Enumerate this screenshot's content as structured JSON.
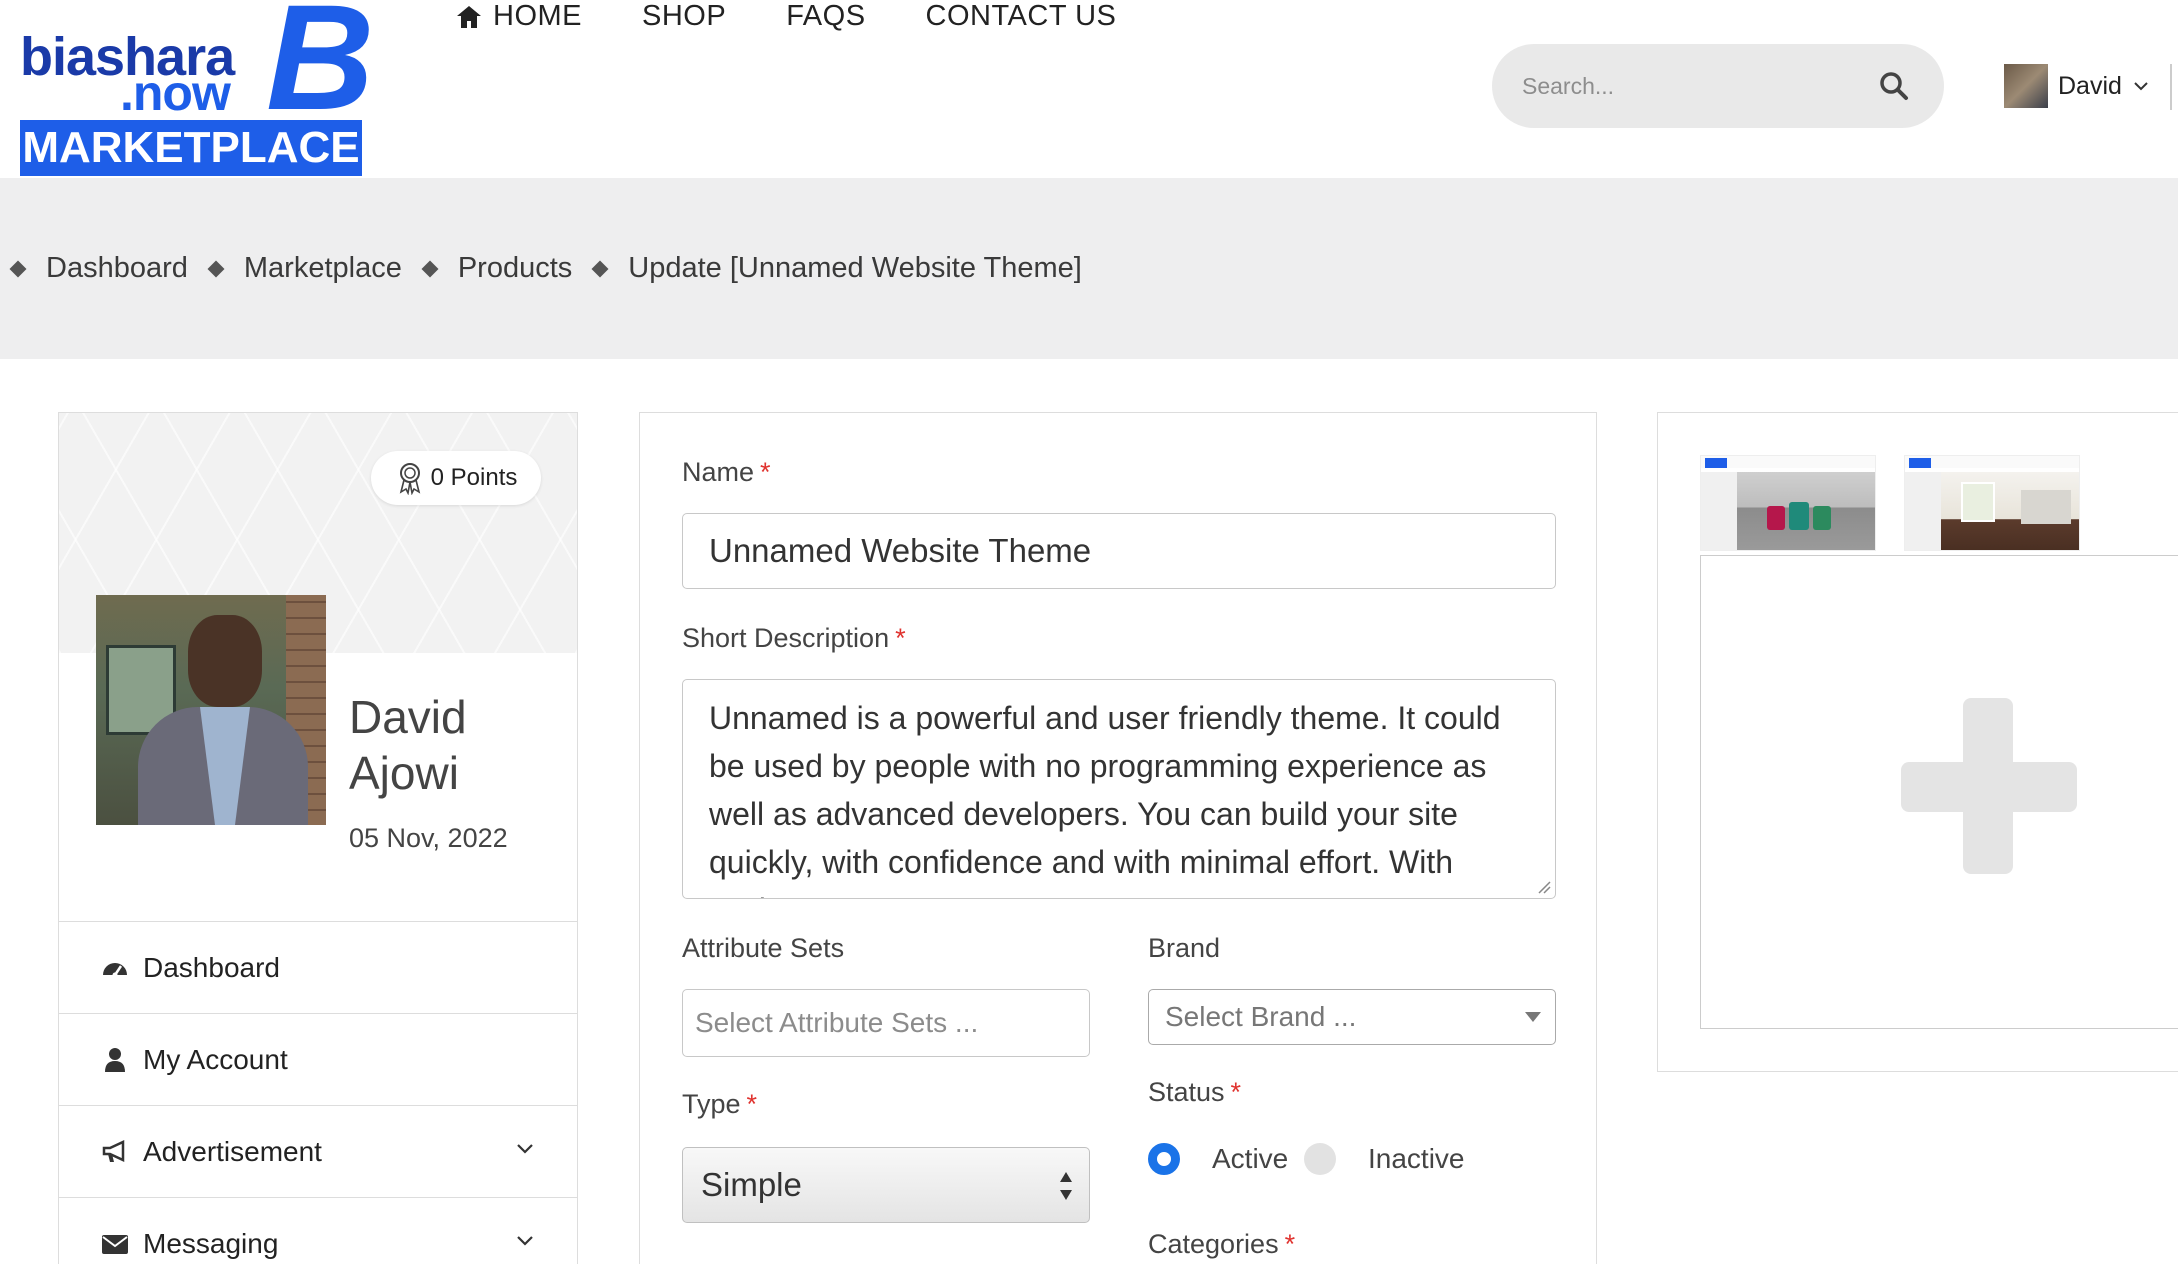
{
  "brand": {
    "word1": "biashara",
    "word2": ".now",
    "badge": "MARKETPLACE",
    "accent": "#1e5ee8"
  },
  "nav": {
    "home": "HOME",
    "shop": "SHOP",
    "faqs": "FAQS",
    "contact": "CONTACT US"
  },
  "search": {
    "placeholder": "Search..."
  },
  "user": {
    "name": "David"
  },
  "breadcrumb": [
    "Dashboard",
    "Marketplace",
    "Products",
    "Update [Unnamed Website Theme]"
  ],
  "profile": {
    "points": "0 Points",
    "first_name": "David",
    "last_name": "Ajowi",
    "date": "05 Nov, 2022",
    "menu": [
      {
        "label": "Dashboard",
        "icon": "dashboard-icon"
      },
      {
        "label": "My Account",
        "icon": "user-icon"
      },
      {
        "label": "Advertisement",
        "icon": "megaphone-icon",
        "expandable": true
      },
      {
        "label": "Messaging",
        "icon": "envelope-icon",
        "expandable": true
      }
    ]
  },
  "form": {
    "name_label": "Name",
    "name_value": "Unnamed Website Theme",
    "short_desc_label": "Short Description",
    "short_desc_value": "Unnamed is a powerful and user friendly theme. It could be used by people with no programming experience as well as advanced developers. You can build your site quickly, with confidence and with minimal effort. With such",
    "attr_label": "Attribute Sets",
    "attr_placeholder": "Select Attribute Sets ...",
    "brand_label": "Brand",
    "brand_placeholder": "Select Brand ...",
    "type_label": "Type",
    "type_value": "Simple",
    "status_label": "Status",
    "status_active": "Active",
    "status_inactive": "Inactive",
    "status_selected": "Active",
    "categories_label": "Categories",
    "required_mark": "*"
  },
  "colors": {
    "required": "#e0332f",
    "radio": "#1a73e8",
    "band": "#eeeeef"
  }
}
